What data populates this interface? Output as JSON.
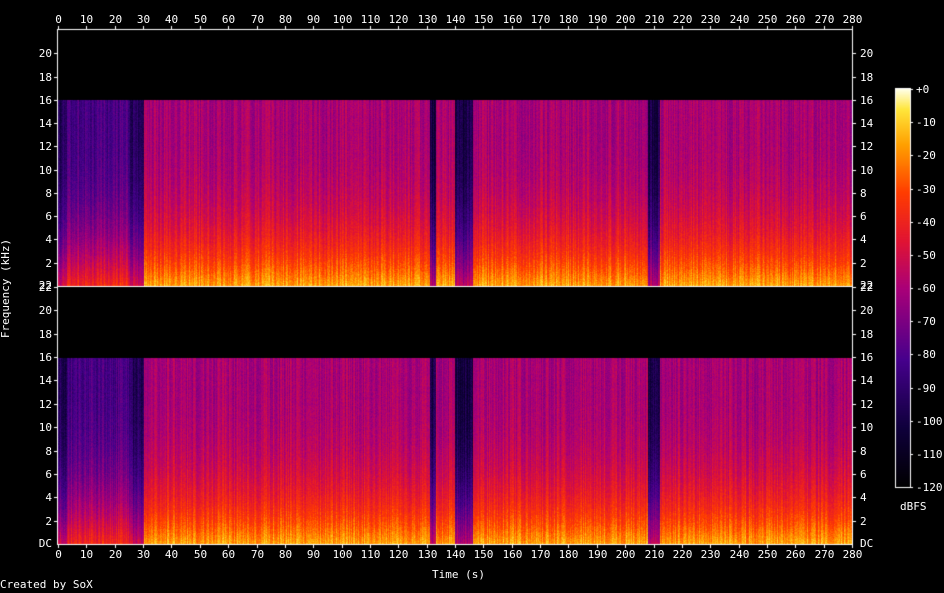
{
  "chart_data": {
    "type": "heatmap",
    "title": "",
    "xlabel": "Time (s)",
    "ylabel": "Frequency (kHz)",
    "x_ticks": [
      "0",
      "10",
      "20",
      "30",
      "40",
      "50",
      "60",
      "70",
      "80",
      "90",
      "100",
      "110",
      "120",
      "130",
      "140",
      "150",
      "160",
      "170",
      "180",
      "190",
      "200",
      "210",
      "220",
      "230",
      "240",
      "250",
      "260",
      "270",
      "280"
    ],
    "xlim": [
      0,
      280
    ],
    "channels": [
      {
        "y_ticks": [
          "2",
          "4",
          "6",
          "8",
          "10",
          "12",
          "14",
          "16",
          "18",
          "20",
          "22"
        ],
        "y_base_label": "22"
      },
      {
        "y_ticks": [
          "2",
          "4",
          "6",
          "8",
          "10",
          "12",
          "14",
          "16",
          "18",
          "20",
          "22"
        ],
        "y_base_label": "DC"
      }
    ],
    "ylim_khz": [
      0,
      22
    ],
    "bandwidth_khz": 16,
    "colorbar": {
      "label": "dBFS",
      "ticks": [
        "+0",
        "-10",
        "-20",
        "-30",
        "-40",
        "-50",
        "-60",
        "-70",
        "-80",
        "-90",
        "-100",
        "-110",
        "-120"
      ],
      "range_dbfs": [
        -120,
        0
      ]
    },
    "segments_s": [
      {
        "from": 0,
        "to": 3,
        "level_db": -95
      },
      {
        "from": 3,
        "to": 25,
        "level_db": -82
      },
      {
        "from": 25,
        "to": 30,
        "level_db": -95
      },
      {
        "from": 30,
        "to": 280,
        "level_db": -60
      }
    ],
    "quiet_gaps_s": [
      [
        131,
        133
      ],
      [
        140,
        146
      ],
      [
        208,
        212
      ]
    ],
    "footer": "Created by SoX",
    "colors": {
      "background": "#000000",
      "text": "#ffffff"
    }
  }
}
